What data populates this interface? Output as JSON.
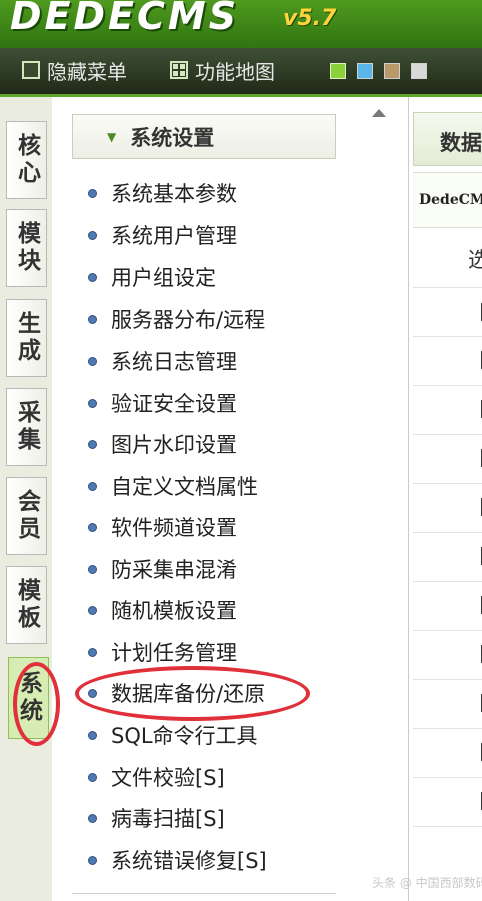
{
  "header": {
    "logo_text": "DEDECMS",
    "version": "v5.7"
  },
  "toolbar": {
    "hide_menu": "隐藏菜单",
    "site_map": "功能地图",
    "theme_swatches": [
      "#8bd13a",
      "#5bb6e8",
      "#b89a6a",
      "#d8d8d8"
    ]
  },
  "left_tabs": [
    {
      "label": "核心",
      "active": false
    },
    {
      "label": "模块",
      "active": false
    },
    {
      "label": "生成",
      "active": false
    },
    {
      "label": "采集",
      "active": false
    },
    {
      "label": "会员",
      "active": false
    },
    {
      "label": "模板",
      "active": false
    },
    {
      "label": "系统",
      "active": true
    }
  ],
  "menu": {
    "section_title": "系统设置",
    "items": [
      "系统基本参数",
      "系统用户管理",
      "用户组设定",
      "服务器分布/远程",
      "系统日志管理",
      "验证安全设置",
      "图片水印设置",
      "自定义文档属性",
      "软件频道设置",
      "防采集串混淆",
      "随机模板设置",
      "计划任务管理",
      "数据库备份/还原",
      "SQL命令行工具",
      "文件校验[S]",
      "病毒扫描[S]",
      "系统错误修复[S]"
    ],
    "highlighted": "数据库备份/还原"
  },
  "content": {
    "tab_label": "数据",
    "subtitle": "DedeCM",
    "row_text": "选"
  },
  "watermark": "头条 @ 中国西部数码",
  "colors": {
    "header_green": "#3f8a18",
    "annotation_red": "#e0303a",
    "bullet_blue": "#5079b2"
  }
}
